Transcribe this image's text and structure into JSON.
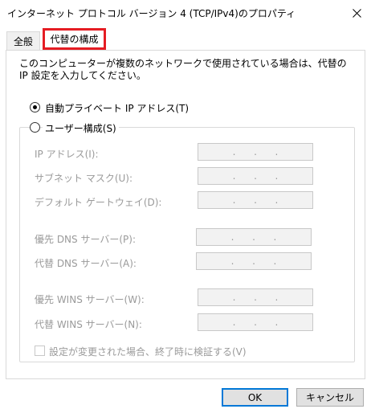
{
  "window": {
    "title": "インターネット プロトコル バージョン 4 (TCP/IPv4)のプロパティ"
  },
  "tabs": [
    {
      "label": "全般"
    },
    {
      "label": "代替の構成"
    }
  ],
  "description": "このコンピューターが複数のネットワークで使用されている場合は、代替の IP 設定を入力してください。",
  "options": {
    "auto_label": "自動プライベート IP アドレス(T)",
    "user_label": "ユーザー構成(S)",
    "selected": "auto"
  },
  "fields": {
    "ip_address": "IP アドレス(I):",
    "subnet_mask": "サブネット マスク(U):",
    "default_gateway": "デフォルト ゲートウェイ(D):",
    "preferred_dns": "優先 DNS サーバー(P):",
    "alternate_dns": "代替 DNS サーバー(A):",
    "preferred_wins": "優先 WINS サーバー(W):",
    "alternate_wins": "代替 WINS サーバー(N):"
  },
  "ip_separator": ".",
  "validate_label": "設定が変更された場合、終了時に検証する(V)",
  "buttons": {
    "ok": "OK",
    "cancel": "キャンセル"
  },
  "colors": {
    "highlight": "#e51c23",
    "disabled_text": "#9a9a9a",
    "accent": "#0078d7"
  }
}
